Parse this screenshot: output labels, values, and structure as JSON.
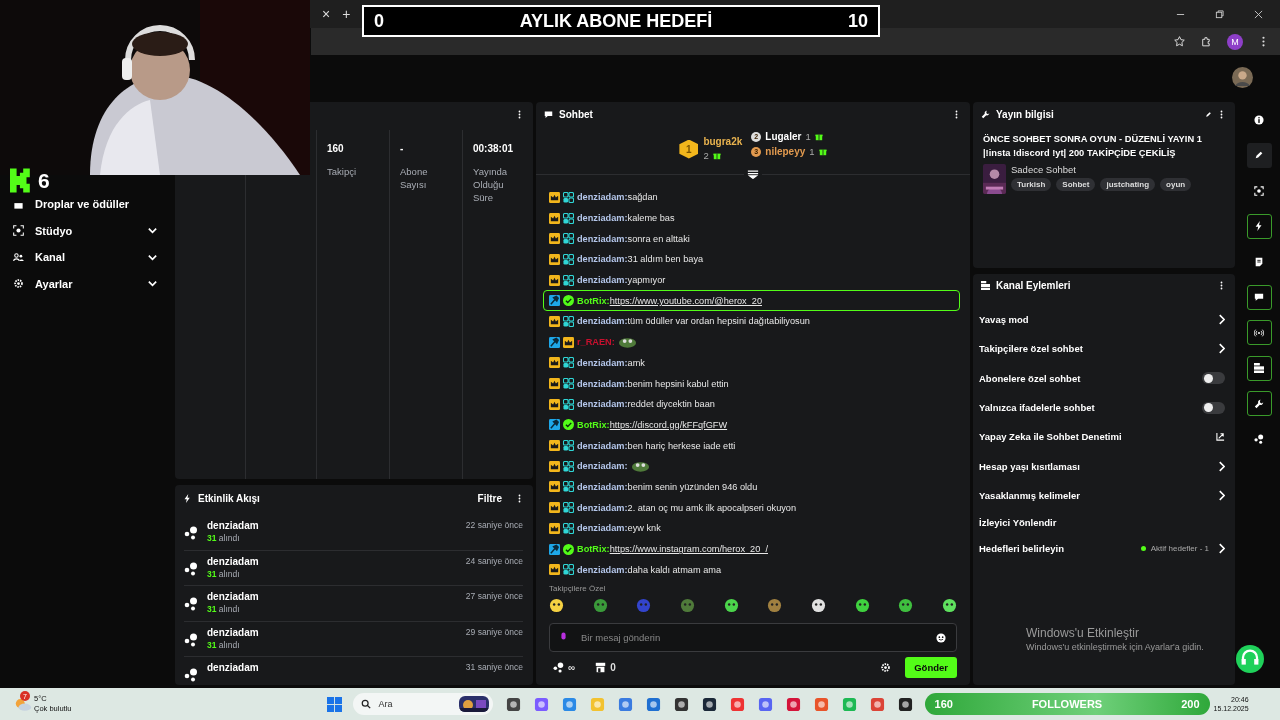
{
  "browser": {
    "tab_close": "×",
    "new_tab": "+",
    "profile": "M"
  },
  "goal_overlay": {
    "current": "0",
    "title": "AYLIK ABONE HEDEFİ",
    "target": "10"
  },
  "logo_overlay": {
    "number": "6"
  },
  "sidebar": {
    "items": [
      {
        "label": "Droplar ve ödüller",
        "kind": "plain"
      },
      {
        "label": "Stüdyo",
        "kind": "studio",
        "expanded": false
      },
      {
        "label": "Kanal",
        "kind": "channel",
        "expanded": false
      },
      {
        "label": "Ayarlar",
        "kind": "settings",
        "expanded": false
      }
    ]
  },
  "stats": {
    "columns": [
      {
        "value": "160",
        "label": "Takipçi"
      },
      {
        "value": "-",
        "label": "Abone Sayısı"
      },
      {
        "value": "00:38:01",
        "label": "Yayında Olduğu Süre"
      }
    ]
  },
  "events": {
    "title": "Etkinlik Akışı",
    "filter": "Filtre",
    "items": [
      {
        "name": "denziadam",
        "amount": "31",
        "label": "alındı",
        "time": "22 saniye önce"
      },
      {
        "name": "denziadam",
        "amount": "31",
        "label": "alındı",
        "time": "24 saniye önce"
      },
      {
        "name": "denziadam",
        "amount": "31",
        "label": "alındı",
        "time": "27 saniye önce"
      },
      {
        "name": "denziadam",
        "amount": "31",
        "label": "alındı",
        "time": "29 saniye önce"
      },
      {
        "name": "denziadam",
        "time": "31 saniye önce"
      }
    ]
  },
  "chat": {
    "title": "Sohbet",
    "leaders": [
      {
        "rank": "1",
        "name": "bugra2k",
        "count": "2"
      },
      {
        "rank": "2",
        "name": "Lugaler",
        "count": "1"
      },
      {
        "rank": "3",
        "name": "nilepeyy",
        "count": "1"
      }
    ],
    "messages": [
      {
        "name": "denziadam:",
        "color": "#b4c6ea",
        "badges": [
          {
            "kind": "crown"
          },
          {
            "kind": "og"
          }
        ],
        "kind": "text",
        "text": "sağdan",
        "highlighted": false
      },
      {
        "name": "denziadam:",
        "color": "#b4c6ea",
        "badges": [
          {
            "kind": "crown"
          },
          {
            "kind": "og"
          }
        ],
        "kind": "text",
        "text": "kaleme bas",
        "highlighted": false
      },
      {
        "name": "denziadam:",
        "color": "#b4c6ea",
        "badges": [
          {
            "kind": "crown"
          },
          {
            "kind": "og"
          }
        ],
        "kind": "text",
        "text": "sonra en alttaki",
        "highlighted": false
      },
      {
        "name": "denziadam:",
        "color": "#b4c6ea",
        "badges": [
          {
            "kind": "crown"
          },
          {
            "kind": "og"
          }
        ],
        "kind": "text",
        "text": "31 aldım ben baya",
        "highlighted": false
      },
      {
        "name": "denziadam:",
        "color": "#b4c6ea",
        "badges": [
          {
            "kind": "crown"
          },
          {
            "kind": "og"
          }
        ],
        "kind": "text",
        "text": "yapmıyor",
        "highlighted": false
      },
      {
        "name": "BotRix:",
        "color": "#53fc18",
        "badges": [
          {
            "kind": "mod"
          },
          {
            "kind": "verified"
          }
        ],
        "kind": "link",
        "text": "https://www.youtube.com/@herox_20",
        "highlighted": true
      },
      {
        "name": "denziadam:",
        "color": "#b4c6ea",
        "badges": [
          {
            "kind": "crown"
          },
          {
            "kind": "og"
          }
        ],
        "kind": "text",
        "text": "tüm ödüller var ordan hepsini dağıtabiliyosun",
        "highlighted": false
      },
      {
        "name": "r_RAEN:",
        "color": "#c8102e",
        "badges": [
          {
            "kind": "mod"
          },
          {
            "kind": "crown"
          }
        ],
        "kind": "emote",
        "highlighted": false
      },
      {
        "name": "denziadam:",
        "color": "#b4c6ea",
        "badges": [
          {
            "kind": "crown"
          },
          {
            "kind": "og"
          }
        ],
        "kind": "text",
        "text": "amk",
        "highlighted": false
      },
      {
        "name": "denziadam:",
        "color": "#b4c6ea",
        "badges": [
          {
            "kind": "crown"
          },
          {
            "kind": "og"
          }
        ],
        "kind": "text",
        "text": "benim hepsini kabul ettin",
        "highlighted": false
      },
      {
        "name": "denziadam:",
        "color": "#b4c6ea",
        "badges": [
          {
            "kind": "crown"
          },
          {
            "kind": "og"
          }
        ],
        "kind": "text",
        "text": "reddet diycektin baan",
        "highlighted": false
      },
      {
        "name": "BotRix:",
        "color": "#53fc18",
        "badges": [
          {
            "kind": "mod"
          },
          {
            "kind": "verified"
          }
        ],
        "kind": "link",
        "text": "https://discord.gg/kFFqfGFW",
        "highlighted": false
      },
      {
        "name": "denziadam:",
        "color": "#b4c6ea",
        "badges": [
          {
            "kind": "crown"
          },
          {
            "kind": "og"
          }
        ],
        "kind": "text",
        "text": "ben hariç herkese iade etti",
        "highlighted": false
      },
      {
        "name": "denziadam:",
        "color": "#b4c6ea",
        "badges": [
          {
            "kind": "crown"
          },
          {
            "kind": "og"
          }
        ],
        "kind": "emote",
        "highlighted": false
      },
      {
        "name": "denziadam:",
        "color": "#b4c6ea",
        "badges": [
          {
            "kind": "crown"
          },
          {
            "kind": "og"
          }
        ],
        "kind": "text",
        "text": "benim senin yüzünden 946 oldu",
        "highlighted": false
      },
      {
        "name": "denziadam:",
        "color": "#b4c6ea",
        "badges": [
          {
            "kind": "crown"
          },
          {
            "kind": "og"
          }
        ],
        "kind": "text",
        "text": "2. atan oç mu amk ilk apocalpseri okuyon",
        "highlighted": false
      },
      {
        "name": "denziadam:",
        "color": "#b4c6ea",
        "badges": [
          {
            "kind": "crown"
          },
          {
            "kind": "og"
          }
        ],
        "kind": "text",
        "text": "eyw knk",
        "highlighted": false
      },
      {
        "name": "BotRix:",
        "color": "#53fc18",
        "badges": [
          {
            "kind": "mod"
          },
          {
            "kind": "verified"
          }
        ],
        "kind": "link",
        "text": "https://www.instagram.com/herox_20_/",
        "highlighted": false
      },
      {
        "name": "denziadam:",
        "color": "#b4c6ea",
        "badges": [
          {
            "kind": "crown"
          },
          {
            "kind": "og"
          }
        ],
        "kind": "text",
        "text": "daha kaldı atmam ama",
        "highlighted": false
      }
    ],
    "emote_section": "Takipçilere Özel",
    "input": {
      "placeholder": "Bir mesaj gönderin"
    },
    "points": "∞",
    "store_count": "0",
    "send": "Gönder"
  },
  "stream_info": {
    "title": "Yayın bilgisi",
    "stream_title": "ÖNCE SOHBET SONRA OYUN - DÜZENLİ YAYIN 1 |!insta !discord !yt| 200 TAKİPÇİDE ÇEKİLİŞ",
    "category": "Sadece Sohbet",
    "tags": [
      "Turkish",
      "Sohbet",
      "justchating",
      "oyun"
    ]
  },
  "channel_actions": {
    "title": "Kanal Eylemleri",
    "items": [
      {
        "label": "Yavaş mod",
        "kind": "chevron"
      },
      {
        "label": "Takipçilere özel sohbet",
        "kind": "chevron"
      },
      {
        "label": "Abonelere özel sohbet",
        "kind": "toggle",
        "on": false
      },
      {
        "label": "Yalnızca ifadelerle sohbet",
        "kind": "toggle",
        "on": false
      },
      {
        "label": "Yapay Zeka ile Sohbet Denetimi",
        "kind": "external"
      },
      {
        "label": "Hesap yaşı kısıtlaması",
        "kind": "chevron"
      },
      {
        "label": "Yasaklanmış kelimeler",
        "kind": "chevron"
      },
      {
        "label": "İzleyici Yönlendir",
        "kind": "plain"
      },
      {
        "label": "Hedefleri belirleyin",
        "kind": "goals",
        "status": "Aktif hedefler - 1"
      }
    ]
  },
  "rail": [
    {
      "kind": "info",
      "selected": false,
      "highlighted": false
    },
    {
      "kind": "pencil",
      "selected": true,
      "highlighted": false
    },
    {
      "kind": "focus",
      "selected": false,
      "highlighted": false
    },
    {
      "kind": "bolt",
      "selected": false,
      "highlighted": true
    },
    {
      "kind": "note",
      "selected": false,
      "highlighted": false
    },
    {
      "kind": "chat",
      "selected": false,
      "highlighted": true
    },
    {
      "kind": "broadcast",
      "selected": false,
      "highlighted": true
    },
    {
      "kind": "layout",
      "selected": false,
      "highlighted": true
    },
    {
      "kind": "wrench",
      "selected": false,
      "highlighted": true
    },
    {
      "kind": "dots",
      "selected": false,
      "highlighted": false
    }
  ],
  "activation": {
    "title": "Windows'u Etkinleştir",
    "text": "Windows'u etkinleştirmek için Ayarlar'a gidin."
  },
  "taskbar": {
    "weather": {
      "badge": "7",
      "temp": "5°C",
      "desc": "Çok bulutlu"
    },
    "search": "Ara",
    "followers": {
      "current": "160",
      "label": "FOLLOWERS",
      "target": "200"
    },
    "clock": {
      "time": "20:46",
      "date": "15.12.2025"
    }
  }
}
